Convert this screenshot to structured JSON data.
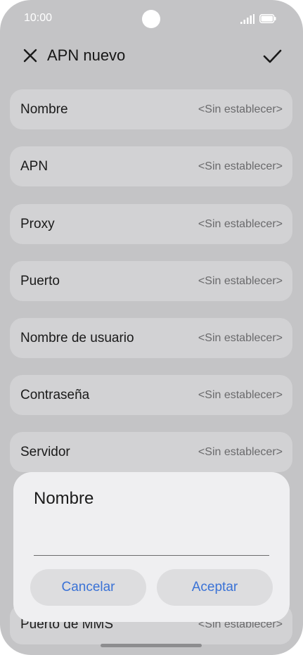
{
  "status_bar": {
    "time": "10:00",
    "icons": [
      "signal-icon",
      "battery-icon"
    ]
  },
  "header": {
    "title": "APN nuevo",
    "close_icon": "close-icon",
    "confirm_icon": "check-icon"
  },
  "fields": [
    {
      "label": "Nombre",
      "value": "<Sin establecer>"
    },
    {
      "label": "APN",
      "value": "<Sin establecer>"
    },
    {
      "label": "Proxy",
      "value": "<Sin establecer>"
    },
    {
      "label": "Puerto",
      "value": "<Sin establecer>"
    },
    {
      "label": "Nombre de usuario",
      "value": "<Sin establecer>"
    },
    {
      "label": "Contraseña",
      "value": "<Sin establecer>"
    },
    {
      "label": "Servidor",
      "value": "<Sin establecer>"
    },
    {
      "label": "Puerto de MMS",
      "value": "<Sin establecer>"
    }
  ],
  "dialog": {
    "title": "Nombre",
    "input_value": "",
    "cancel_label": "Cancelar",
    "accept_label": "Aceptar"
  },
  "colors": {
    "overlay_background": "#c4c4c6",
    "row_background": "#d2d2d4",
    "dialog_background": "#efeff1",
    "button_text": "#3a72d6"
  }
}
